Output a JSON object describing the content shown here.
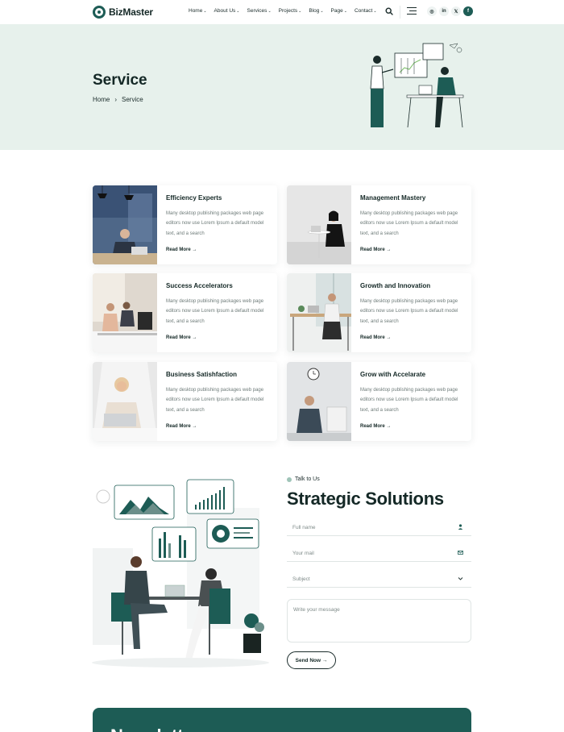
{
  "brand": {
    "name": "BizMaster",
    "accent": "#1d5c55",
    "hero_bg": "#e7f1ec"
  },
  "nav": {
    "items": [
      {
        "label": "Home"
      },
      {
        "label": "About Us"
      },
      {
        "label": "Services"
      },
      {
        "label": "Projects"
      },
      {
        "label": "Blog"
      },
      {
        "label": "Page"
      },
      {
        "label": "Contact"
      }
    ],
    "search_icon": "search-icon",
    "menu_icon": "hamburger-icon",
    "socials": [
      {
        "icon": "instagram-icon",
        "glyph": "◎"
      },
      {
        "icon": "linkedin-icon",
        "glyph": "in"
      },
      {
        "icon": "x-icon",
        "glyph": "𝕏"
      },
      {
        "icon": "facebook-icon",
        "glyph": "f"
      }
    ]
  },
  "hero": {
    "title": "Service",
    "breadcrumb": {
      "home": "Home",
      "separator": "›",
      "current": "Service"
    }
  },
  "services": [
    {
      "title": "Efficiency Experts",
      "desc": "Many desktop publishing packages web page editors now use Lorem Ipsum a default model text, and a search",
      "link": "Read More"
    },
    {
      "title": "Management Mastery",
      "desc": "Many desktop publishing packages web page editors now use Lorem Ipsum a default model text, and a search",
      "link": "Read More"
    },
    {
      "title": "Success Accelerators",
      "desc": "Many desktop publishing packages web page editors now use Lorem Ipsum a default model text, and a search",
      "link": "Read More"
    },
    {
      "title": "Growth and Innovation",
      "desc": "Many desktop publishing packages web page editors now use Lorem Ipsum a default model text, and a search",
      "link": "Read More"
    },
    {
      "title": "Business Satishfaction",
      "desc": "Many desktop publishing packages web page editors now use Lorem Ipsum a default model text, and a search",
      "link": "Read More"
    },
    {
      "title": "Grow with Accelarate",
      "desc": "Many desktop publishing packages web page editors now use Lorem Ipsum a default model text, and a search",
      "link": "Read More"
    }
  ],
  "contact": {
    "eyebrow": "Talk to Us",
    "title": "Strategic Solutions",
    "fields": {
      "name_placeholder": "Full name",
      "mail_placeholder": "Your mail",
      "subject_placeholder": "Subject",
      "message_placeholder": "Write your message"
    },
    "submit": "Send Now →"
  },
  "newsletter": {
    "title": "Newsletter"
  }
}
